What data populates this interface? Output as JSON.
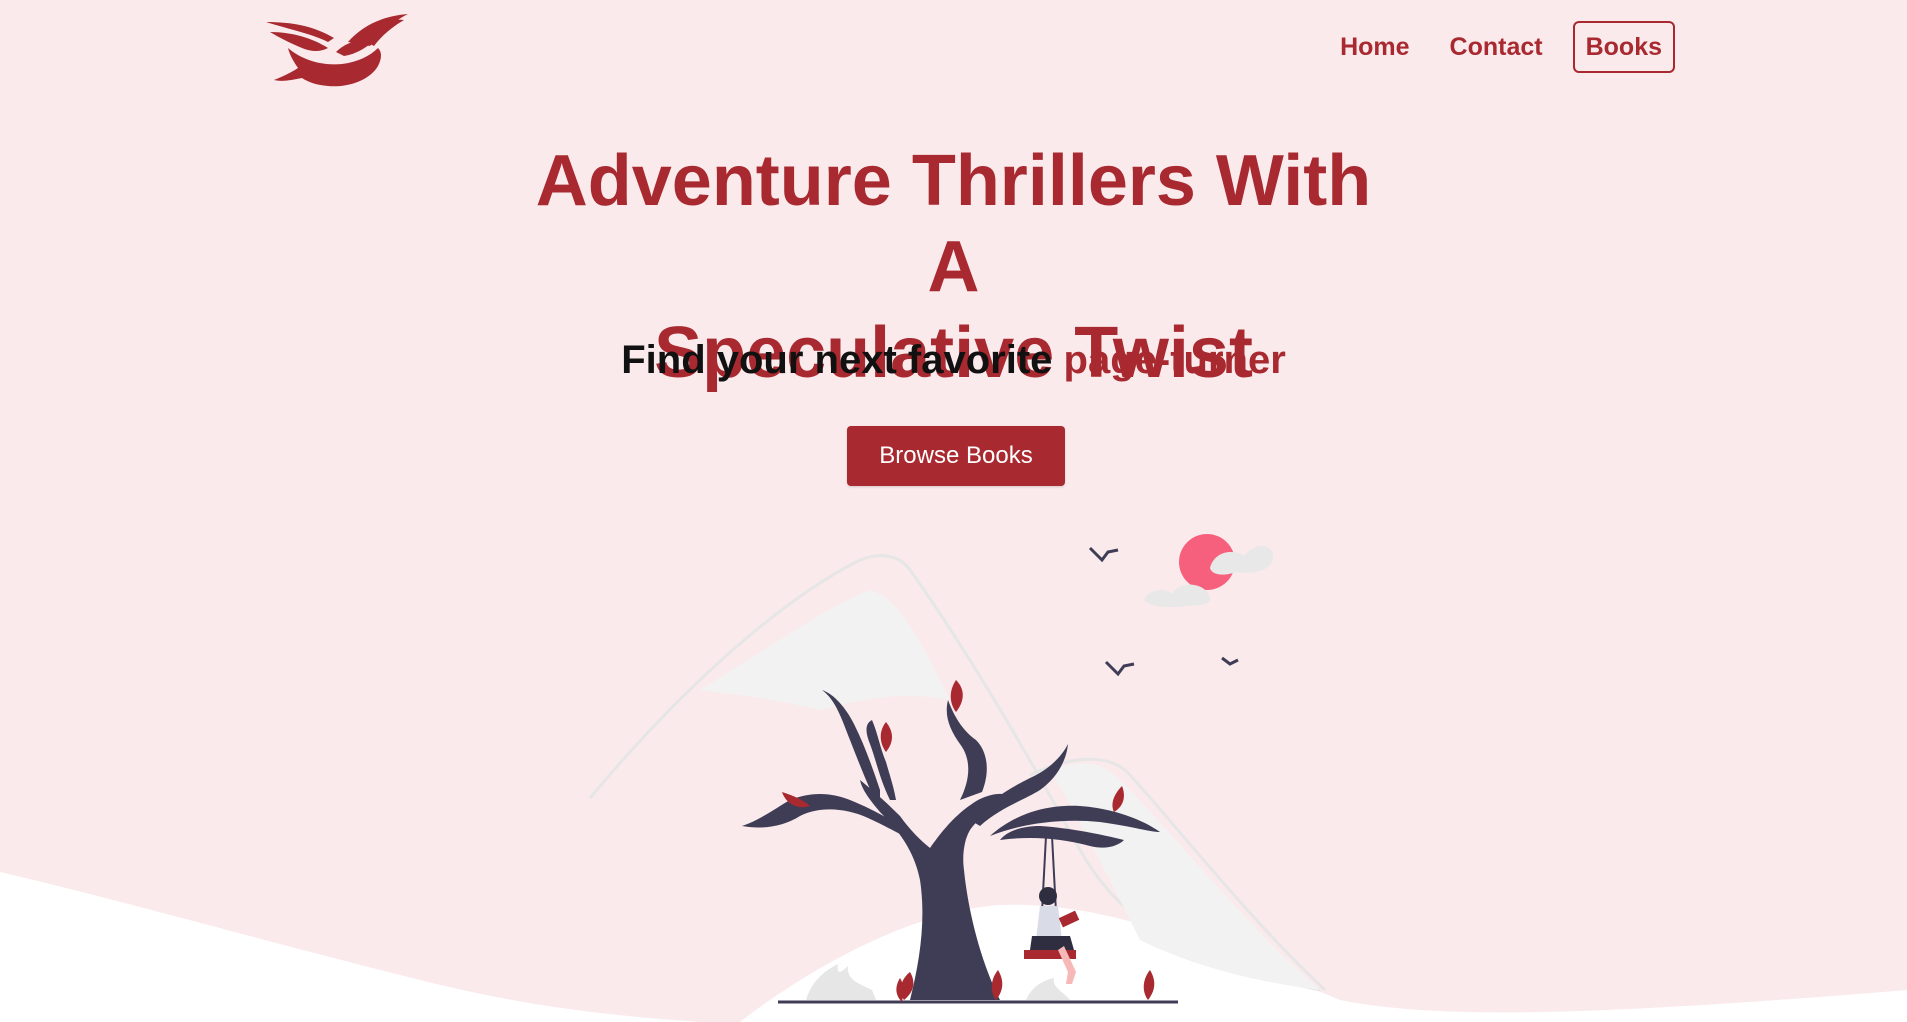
{
  "nav": {
    "items": [
      {
        "label": "Home",
        "active": false
      },
      {
        "label": "Contact",
        "active": false
      },
      {
        "label": "Books",
        "active": true
      }
    ]
  },
  "hero": {
    "title_line1": "Adventure Thrillers With A",
    "title_line2": "Speculative Twist",
    "subtitle_prefix": "Find your next favorite ",
    "subtitle_accent": "page-turner",
    "cta_label": "Browse Books"
  },
  "colors": {
    "background": "#faeaec",
    "accent": "#a8292f",
    "tree": "#3f3d56",
    "sun": "#f7607d"
  },
  "icons": {
    "logo": "bird-logo",
    "illustration": "reading-on-swing-tree-illustration"
  }
}
